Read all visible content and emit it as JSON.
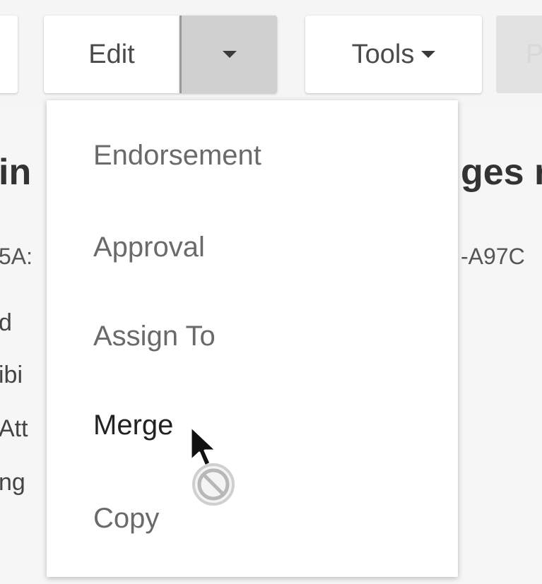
{
  "toolbar": {
    "edit_label": "Edit",
    "tools_label": "Tools",
    "next_button_partial": "P"
  },
  "background": {
    "title_left_partial": "in",
    "title_right_partial": "ges r",
    "code_left_partial": "5A:",
    "code_right_partial": "-A97C",
    "fields_partial": [
      "d",
      "ibi",
      "Att",
      "ng"
    ]
  },
  "edit_menu": {
    "items": [
      {
        "label": "Endorsement"
      },
      {
        "label": "Approval"
      },
      {
        "label": "Assign To"
      },
      {
        "label": "Merge"
      },
      {
        "label": "Copy"
      }
    ],
    "hovered_item": "Merge"
  },
  "cursor": {
    "icon": "not-allowed-cursor"
  }
}
